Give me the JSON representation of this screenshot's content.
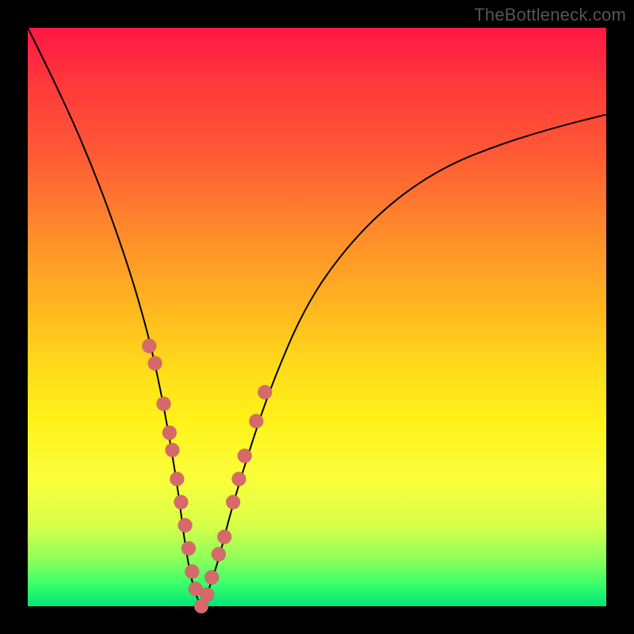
{
  "watermark": "TheBottleneck.com",
  "chart_data": {
    "type": "line",
    "title": "",
    "xlabel": "",
    "ylabel": "",
    "xlim": [
      0,
      100
    ],
    "ylim": [
      0,
      100
    ],
    "series": [
      {
        "name": "bottleneck-curve",
        "x": [
          0,
          6,
          12,
          17,
          20,
          22,
          24,
          26,
          27,
          28,
          29,
          30,
          31,
          33,
          35,
          38,
          42,
          48,
          55,
          63,
          72,
          82,
          92,
          100
        ],
        "y": [
          100,
          88,
          74,
          60,
          50,
          42,
          32,
          20,
          12,
          6,
          2,
          0,
          2,
          8,
          16,
          26,
          38,
          52,
          62,
          70,
          76,
          80,
          83,
          85
        ]
      }
    ],
    "beads": {
      "name": "highlight-points",
      "x": [
        21.0,
        22.0,
        23.5,
        24.5,
        25.0,
        25.8,
        26.5,
        27.2,
        27.8,
        28.4,
        29.0,
        30.0,
        31.0,
        31.8,
        33.0,
        34.0,
        35.5,
        36.5,
        37.5,
        39.5,
        41.0
      ],
      "y": [
        45,
        42,
        35,
        30,
        27,
        22,
        18,
        14,
        10,
        6,
        3,
        0,
        2,
        5,
        9,
        12,
        18,
        22,
        26,
        32,
        37
      ]
    },
    "gradient_stops": [
      {
        "pos": 0,
        "color": "#ff1744"
      },
      {
        "pos": 50,
        "color": "#ffd91a"
      },
      {
        "pos": 100,
        "color": "#00e676"
      }
    ]
  }
}
